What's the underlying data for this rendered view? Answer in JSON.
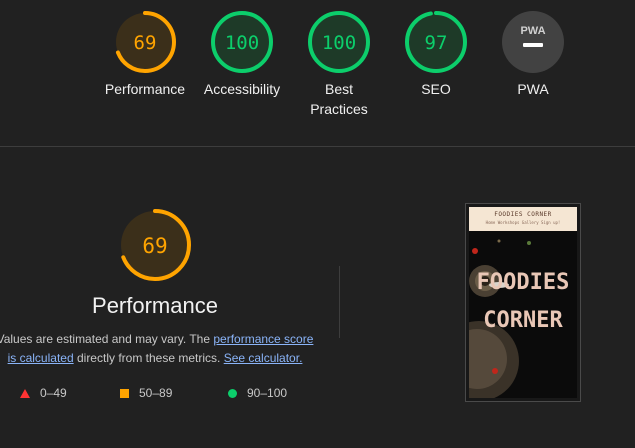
{
  "categories": [
    {
      "id": "performance",
      "score": "69",
      "label": "Performance",
      "level": 0.69,
      "color": "#ffa400",
      "track": "#3b2f1a"
    },
    {
      "id": "accessibility",
      "score": "100",
      "label": "Accessibility",
      "level": 1.0,
      "color": "#0cce6b",
      "track": "#1e3a28"
    },
    {
      "id": "best-practices",
      "score": "100",
      "label": "Best Practices",
      "level": 1.0,
      "color": "#0cce6b",
      "track": "#1e3a28"
    },
    {
      "id": "seo",
      "score": "97",
      "label": "SEO",
      "level": 0.97,
      "color": "#0cce6b",
      "track": "#1e3a28"
    },
    {
      "id": "pwa",
      "score": "PWA",
      "label": "PWA",
      "level": 0,
      "color": "#9e9e9e",
      "track": "#424242"
    }
  ],
  "detail": {
    "score": "69",
    "level": 0.69,
    "title": "Performance",
    "desc_prefix": "Values are estimated and may vary. The ",
    "link_score": "performance score is calculated",
    "desc_middle": " directly from these metrics. ",
    "link_calc": "See calculator."
  },
  "legend": {
    "fail": "0–49",
    "average": "50–89",
    "pass": "90–100"
  },
  "screenshot": {
    "brand": "FOODIES CORNER",
    "nav": "Home  Workshops  Gallery  Sign up!",
    "hero_line1": "FOODIES",
    "hero_line2": "CORNER"
  }
}
